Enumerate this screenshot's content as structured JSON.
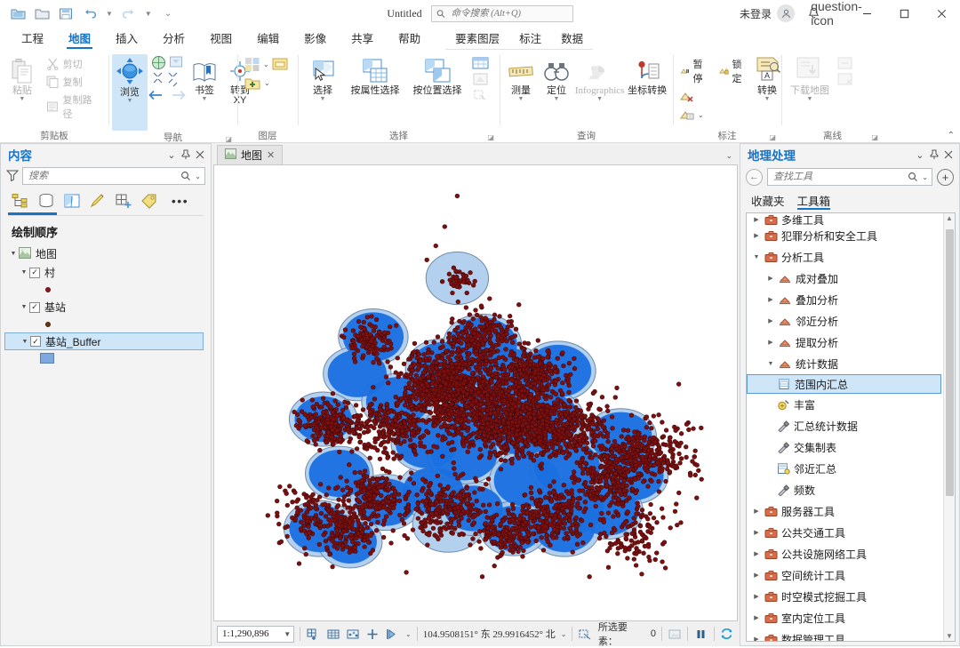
{
  "titlebar": {
    "quick_access": [
      "new-project-icon",
      "open-project-icon",
      "save-project-icon",
      "undo-icon",
      "redo-icon",
      "customize-qat-icon"
    ],
    "doc_title": "Untitled",
    "command_search_placeholder": "命令搜索 (Alt+Q)",
    "sign_in": "未登录",
    "account_icon": "person-icon",
    "notifications_icon": "bell-icon",
    "help_icon": "question-icon",
    "minimize": "—",
    "maximize": "□",
    "close": "✕"
  },
  "ribbon": {
    "tabs": [
      {
        "label": "工程",
        "active": false
      },
      {
        "label": "地图",
        "active": true
      },
      {
        "label": "插入",
        "active": false
      },
      {
        "label": "分析",
        "active": false
      },
      {
        "label": "视图",
        "active": false
      },
      {
        "label": "编辑",
        "active": false
      },
      {
        "label": "影像",
        "active": false
      },
      {
        "label": "共享",
        "active": false
      },
      {
        "label": "帮助",
        "active": false
      }
    ],
    "contextual_tabs": [
      {
        "label": "要素图层"
      },
      {
        "label": "标注"
      },
      {
        "label": "数据"
      }
    ],
    "collapse_icon": "chevron-up-icon",
    "groups": [
      {
        "name": "剪贴板",
        "big": [
          {
            "label": "粘贴",
            "dropdown": true,
            "disabled": true
          }
        ],
        "small": [
          {
            "label": "剪切",
            "disabled": true
          },
          {
            "label": "复制",
            "disabled": true
          },
          {
            "label": "复制路径",
            "disabled": true
          }
        ]
      },
      {
        "name": "导航",
        "big": [
          {
            "label": "浏览",
            "dropdown": true,
            "selected": true
          },
          {
            "label": "书签",
            "dropdown": true
          },
          {
            "label": "转到",
            "label2": "XY"
          }
        ],
        "small": []
      },
      {
        "name": "图层",
        "big": [],
        "small": []
      },
      {
        "name": "选择",
        "big": [
          {
            "label": "选择",
            "dropdown": true
          },
          {
            "label": "按属性选择"
          },
          {
            "label": "按位置选择"
          }
        ],
        "small": []
      },
      {
        "name": "查询",
        "big": [
          {
            "label": "测量",
            "dropdown": true
          },
          {
            "label": "定位",
            "dropdown": true
          },
          {
            "label": "Infographics",
            "dropdown": true,
            "disabled": true
          },
          {
            "label": "坐标转换"
          }
        ],
        "small": []
      },
      {
        "name": "标注",
        "big": [
          {
            "label": "转换",
            "dropdown": true
          }
        ],
        "small": [
          {
            "label": "暂停"
          },
          {
            "label": "锁定"
          }
        ]
      },
      {
        "name": "离线",
        "big": [
          {
            "label": "下载地图",
            "dropdown": true,
            "disabled": true
          }
        ],
        "small": []
      }
    ]
  },
  "contents_pane": {
    "title": "内容",
    "search_placeholder": "搜索",
    "header_icons": [
      "chevron-down-icon",
      "pin-icon",
      "close-icon"
    ],
    "tab_icons": [
      "list-by-drawing-order-icon",
      "list-by-data-source-icon",
      "list-by-selection-icon",
      "list-by-editing-icon",
      "list-by-snapping-icon",
      "list-by-labeling-icon",
      "more-icon"
    ],
    "section_title": "绘制顺序",
    "tree": [
      {
        "label": "地图",
        "type": "map",
        "level": 0,
        "expanded": true
      },
      {
        "label": "村",
        "type": "layer",
        "level": 1,
        "expanded": true,
        "checked": true,
        "symbol": "point",
        "symbol_color": "#8b1a1a"
      },
      {
        "label": "基站",
        "type": "layer",
        "level": 1,
        "expanded": true,
        "checked": true,
        "symbol": "point",
        "symbol_color": "#6b3410"
      },
      {
        "label": "基站_Buffer",
        "type": "layer",
        "level": 1,
        "expanded": true,
        "checked": true,
        "selected": true,
        "symbol": "polygon",
        "symbol_color": "#7ea8e0"
      }
    ]
  },
  "map_view": {
    "tab_label": "地图",
    "tab_close": "✕",
    "overflow_caret": "chevron-down-icon",
    "layers": {
      "buffer_fill": "#1a6fe0",
      "buffer_fill_single": "#a9c9ec",
      "buffer_outline": "#6f8aa8",
      "point_fill": "#7b1010",
      "point_outline": "#3c0606",
      "background": "#ffffff"
    }
  },
  "status_bar": {
    "scale": "1:1,290,896",
    "scale_caret": "chevron-down-icon",
    "tool_icons": [
      "add-grid-icon",
      "grid-icon",
      "graph-icon",
      "plus-icon",
      "arrow-measure-icon"
    ],
    "tools_caret": "chevron-down-icon",
    "coordinates": "104.9508151° 东  29.9916452° 北",
    "coords_caret": "chevron-down-icon",
    "selected_features_label": "所选要素：",
    "selected_features_count": "0",
    "clear_selection_icon": "clear-selection-icon",
    "pause_icon": "pause-icon",
    "refresh_icon": "refresh-icon"
  },
  "geoprocessing_pane": {
    "title": "地理处理",
    "header_icons": [
      "chevron-down-icon",
      "pin-icon",
      "close-icon"
    ],
    "back_icon": "back-arrow-icon",
    "search_placeholder": "查找工具",
    "search_icon": "search-icon",
    "history_caret": "chevron-down-icon",
    "add_icon": "plus-circle-icon",
    "tabs": [
      {
        "label": "收藏夹",
        "active": false
      },
      {
        "label": "工具箱",
        "active": true
      }
    ],
    "tree": [
      {
        "label": "多维工具",
        "level": 0,
        "type": "toolbox",
        "expanded": false,
        "clipped": true
      },
      {
        "label": "犯罪分析和安全工具",
        "level": 0,
        "type": "toolbox",
        "expanded": false
      },
      {
        "label": "分析工具",
        "level": 0,
        "type": "toolbox",
        "expanded": true
      },
      {
        "label": "成对叠加",
        "level": 1,
        "type": "toolset",
        "expanded": false
      },
      {
        "label": "叠加分析",
        "level": 1,
        "type": "toolset",
        "expanded": false
      },
      {
        "label": "邻近分析",
        "level": 1,
        "type": "toolset",
        "expanded": false
      },
      {
        "label": "提取分析",
        "level": 1,
        "type": "toolset",
        "expanded": false
      },
      {
        "label": "统计数据",
        "level": 1,
        "type": "toolset",
        "expanded": true
      },
      {
        "label": "范围内汇总",
        "level": 2,
        "type": "tool-table",
        "selected": true
      },
      {
        "label": "丰富",
        "level": 2,
        "type": "tool-enrich"
      },
      {
        "label": "汇总统计数据",
        "level": 2,
        "type": "tool-hammer"
      },
      {
        "label": "交集制表",
        "level": 2,
        "type": "tool-hammer"
      },
      {
        "label": "邻近汇总",
        "level": 2,
        "type": "tool-table"
      },
      {
        "label": "频数",
        "level": 2,
        "type": "tool-hammer"
      },
      {
        "label": "服务器工具",
        "level": 0,
        "type": "toolbox",
        "expanded": false
      },
      {
        "label": "公共交通工具",
        "level": 0,
        "type": "toolbox",
        "expanded": false
      },
      {
        "label": "公共设施网络工具",
        "level": 0,
        "type": "toolbox",
        "expanded": false
      },
      {
        "label": "空间统计工具",
        "level": 0,
        "type": "toolbox",
        "expanded": false
      },
      {
        "label": "时空模式挖掘工具",
        "level": 0,
        "type": "toolbox",
        "expanded": false
      },
      {
        "label": "室内定位工具",
        "level": 0,
        "type": "toolbox",
        "expanded": false
      },
      {
        "label": "数据管理工具",
        "level": 0,
        "type": "toolbox",
        "expanded": false
      }
    ]
  }
}
